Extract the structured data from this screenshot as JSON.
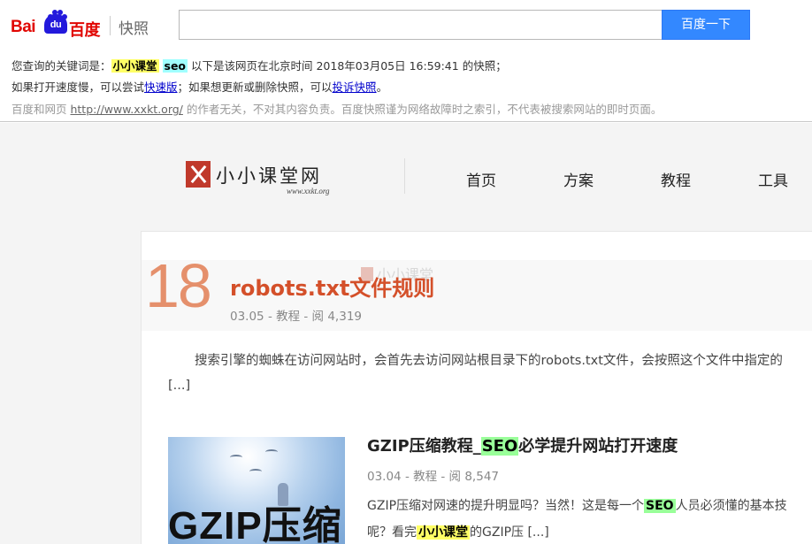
{
  "baidu": {
    "logo_bai": "Bai",
    "logo_du": "du",
    "logo_cn": "百度",
    "snapshot_label": "快照",
    "search_value": "",
    "search_button": "百度一下",
    "line1": {
      "prefix": "您查询的关键词是：",
      "kw1": "小小课堂",
      "kw2": "seo",
      "suffix": " 以下是该网页在北京时间 2018年03月05日 16:59:41 的快照；"
    },
    "line2": {
      "prefix": "如果打开速度慢，可以尝试",
      "fast_link": "快速版",
      "middle": "；如果想更新或删除快照，可以",
      "complain_link": "投诉快照",
      "suffix": "。"
    },
    "line3": {
      "prefix": "百度和网页 ",
      "url": "http://www.xxkt.org/",
      "suffix": " 的作者无关，不对其内容负责。百度快照谨为网络故障时之索引，不代表被搜索网站的即时页面。"
    }
  },
  "site": {
    "logo_name": "小小课堂网",
    "logo_url": "www.xxkt.org",
    "nav": [
      "首页",
      "方案",
      "教程",
      "工具"
    ]
  },
  "post1": {
    "number": "18",
    "title": "robots.txt文件规则",
    "watermark": "小小课堂",
    "meta": "03.05 - 教程 - 阅 4,319",
    "excerpt": "搜索引擎的蜘蛛在访问网站时，会首先去访问网站根目录下的robots.txt文件，会按照这个文件中指定的",
    "more": "[...]"
  },
  "post2": {
    "thumb_text": "GZIP压缩",
    "title_pre": "GZIP压缩教程_",
    "title_kw": "SEO",
    "title_post": "必学提升网站打开速度",
    "meta": "03.04 - 教程 - 阅 8,547",
    "ex1_pre": "GZIP压缩对网速的提升明显吗？当然！这是每一个",
    "ex1_kw": "SEO",
    "ex1_post": "人员必须懂的基本技",
    "ex2_pre": "呢？看完",
    "ex2_kw": "小小课堂",
    "ex2_post": "的GZIP压 [...]"
  },
  "colors": {
    "baidu_red": "#e10602",
    "baidu_blue": "#2319dc",
    "button_blue": "#3388ff",
    "accent_orange": "#d4502a",
    "number_orange": "#e5906c",
    "highlight_yellow": "#ffff66",
    "highlight_green": "#99ff99"
  }
}
